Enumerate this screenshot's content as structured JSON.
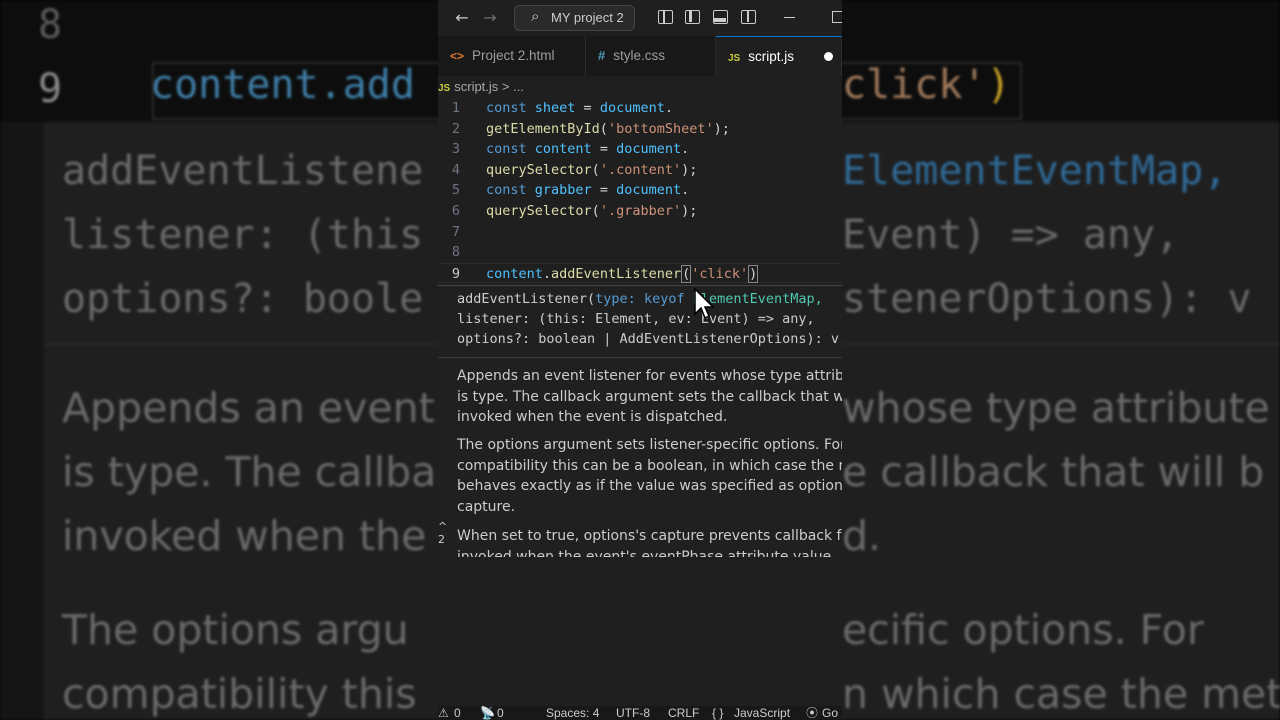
{
  "background": {
    "line8": "8",
    "line9": "9",
    "code9_left": "content.add",
    "code9_right_str": "click'",
    "code9_right_paren": ")",
    "sig1_left": "addEventListene",
    "sig1_right": "ElementEventMap,",
    "sig2_left": "listener: (this",
    "sig2_right": "Event) => any,",
    "sig3_left": "options?: boole",
    "sig3_right": "stenerOptions): v",
    "doc1_left": "Appends an event",
    "doc1_right": "whose type attribute",
    "doc2_left": "is type. The callba",
    "doc2_right": "e callback that will b",
    "doc3_left": "invoked when the",
    "doc3_right": "d.",
    "doc4_left": "The options argu",
    "doc4_right": "ecific options. For",
    "doc5_left": "compatibility this",
    "doc5_right": "n which case the met"
  },
  "titlebar": {
    "back_icon": "arrow-left-icon",
    "forward_icon": "arrow-right-icon",
    "search_text": "MY project 2"
  },
  "tabs": [
    {
      "label": "Project 2.html",
      "icon": "<>",
      "active": false
    },
    {
      "label": "style.css",
      "icon": "#",
      "active": false
    },
    {
      "label": "script.js",
      "icon": "JS",
      "active": true
    }
  ],
  "breadcrumb": {
    "icon": "JS",
    "file": "script.js",
    "sep": ">",
    "rest": "..."
  },
  "code": [
    {
      "n": "1"
    },
    {
      "n": "2"
    },
    {
      "n": "3"
    },
    {
      "n": "4"
    },
    {
      "n": "5"
    },
    {
      "n": "6"
    },
    {
      "n": "7"
    },
    {
      "n": "8"
    },
    {
      "n": "9"
    }
  ],
  "tokens": {
    "const": "const",
    "sheet": "sheet",
    "eq": " = ",
    "document": "document",
    "dot": ".",
    "getElementById": "getElementById",
    "bottomSheet": "'bottomSheet'",
    "content": "content",
    "querySelector": "querySelector",
    "dotContent": "'.content'",
    "grabber": "grabber",
    "dotGrabber": "'.grabber'",
    "addEventListener": "addEventListener",
    "click": "'click'",
    "open": "(",
    "close": ")",
    "closeSemi": ");"
  },
  "hover": {
    "sig1_a": "addEventListener(",
    "sig1_b": "type: keyof",
    "sig1_c": " ElementEventMap,",
    "sig2": "listener: (this: Element, ev: Event) => any,",
    "sig3": "options?: boolean | AddEventListenerOptions): v",
    "para1": "Appends an event listener for events whose type attribute value is type. The callback argument sets the callback that will be invoked when the event is dispatched.",
    "para2": "The options argument sets listener-specific options. For compatibility this can be a boolean, in which case the method behaves exactly as if the value was specified as options's capture.",
    "para3": "When set to true, options's capture prevents callback from being invoked when the event's eventPhase attribute value"
  },
  "gutter": {
    "top": "^",
    "num": "2"
  },
  "statusbar": {
    "errors_icon": "⚠",
    "errors": "0",
    "ports_icon": "📡",
    "ports": "0",
    "spaces": "Spaces: 4",
    "encoding": "UTF-8",
    "eol": "CRLF",
    "braces": "{ }",
    "language": "JavaScript",
    "golive_icon": "⦿",
    "golive": "Go"
  }
}
